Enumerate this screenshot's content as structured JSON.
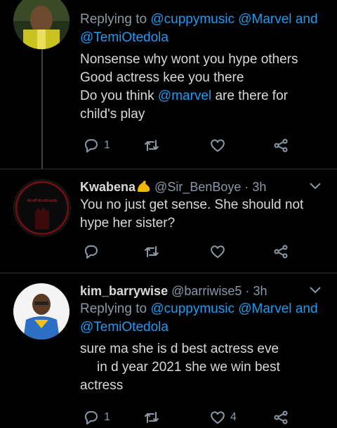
{
  "tweet1": {
    "replying_prefix": "Replying to",
    "replying_users": "@cuppymusic @Marvel",
    "replying_and": "and",
    "replying_user2": "@TemiOtedola",
    "line1": "Nonsense why wont you hype others",
    "line2": "Good actress kee you there",
    "line3_pre": "Do you think",
    "line3_mention": "@marvel",
    "line3_post": "are there for",
    "line4": "child's play",
    "reply_count": "1"
  },
  "tweet2": {
    "name": "Kwabena",
    "handle": "@Sir_BenBoye",
    "dot": "·",
    "time": "3h",
    "avatar_text": "#EndPoliceBrutality",
    "line1": "You no just get sense. She should not",
    "line2": "hype her sister?"
  },
  "tweet3": {
    "name": "kim_barrywise",
    "handle": "@barriwise5",
    "dot": "·",
    "time": "3h",
    "replying_prefix": "Replying to",
    "replying_users": "@cuppymusic @Marvel",
    "replying_and": "and",
    "replying_user2": "@TemiOtedola",
    "line1": "sure ma she is d best actress eve",
    "line2": "in d year 2021 she we win best",
    "line3": "actress",
    "reply_count": "1",
    "like_count": "4"
  },
  "colors": {
    "background": "#000000",
    "text": "#d9d9d9",
    "muted": "#8b98a5",
    "link": "#1d9bf0",
    "divider": "#2f3336"
  },
  "icons": [
    "reply-icon",
    "retweet-icon",
    "like-icon",
    "share-icon",
    "chevron-down-icon",
    "flexed-biceps-emoji"
  ]
}
